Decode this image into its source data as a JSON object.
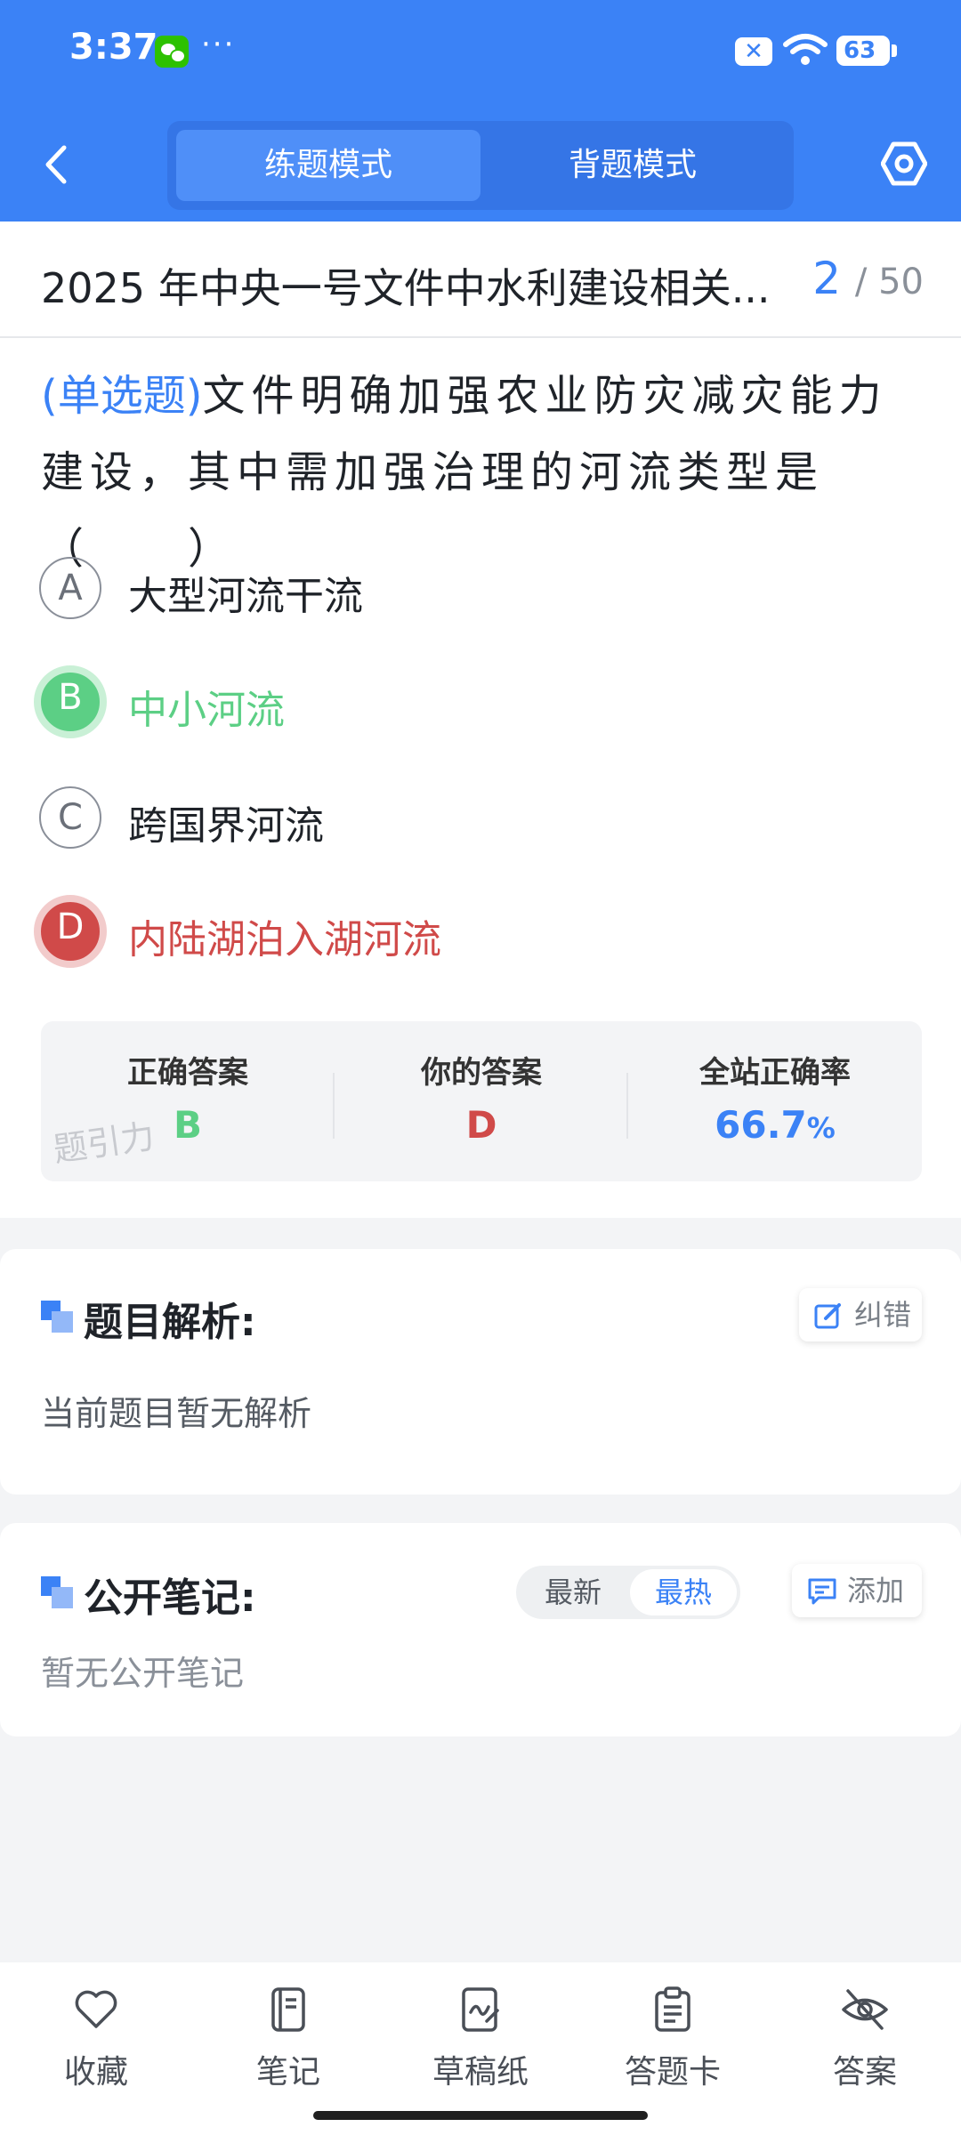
{
  "status_bar": {
    "time": "3:37",
    "more": "···",
    "battery": "63"
  },
  "header": {
    "modes": [
      "练题模式",
      "背题模式"
    ],
    "active_mode": "练题模式"
  },
  "question": {
    "title": "2025 年中央一号文件中水利建设相关...",
    "current": "2",
    "total": "/ 50",
    "type": "(单选题)",
    "stem": "文件明确加强农业防灾减灾能力建设，其中需加强治理的河流类型是（　　）",
    "options": [
      {
        "letter": "A",
        "text": "大型河流干流",
        "state": "normal"
      },
      {
        "letter": "B",
        "text": "中小河流",
        "state": "correct"
      },
      {
        "letter": "C",
        "text": "跨国界河流",
        "state": "normal"
      },
      {
        "letter": "D",
        "text": "内陆湖泊入湖河流",
        "state": "wrong"
      }
    ]
  },
  "answer_summary": {
    "correct_label": "正确答案",
    "correct_value": "B",
    "yours_label": "你的答案",
    "yours_value": "D",
    "rate_label": "全站正确率",
    "rate_value": "66.7",
    "rate_unit": "%",
    "watermark": "题引力"
  },
  "analysis": {
    "title": "题目解析:",
    "report_button": "纠错",
    "body": "当前题目暂无解析"
  },
  "notes": {
    "title": "公开笔记:",
    "sort_options": [
      "最新",
      "最热"
    ],
    "active_sort": "最热",
    "add_button": "添加",
    "body": "暂无公开笔记"
  },
  "toolbar": {
    "items": [
      "收藏",
      "笔记",
      "草稿纸",
      "答题卡",
      "答案"
    ]
  },
  "colors": {
    "primary": "#3b82f6",
    "correct": "#5ccf85",
    "wrong": "#d04a49"
  }
}
